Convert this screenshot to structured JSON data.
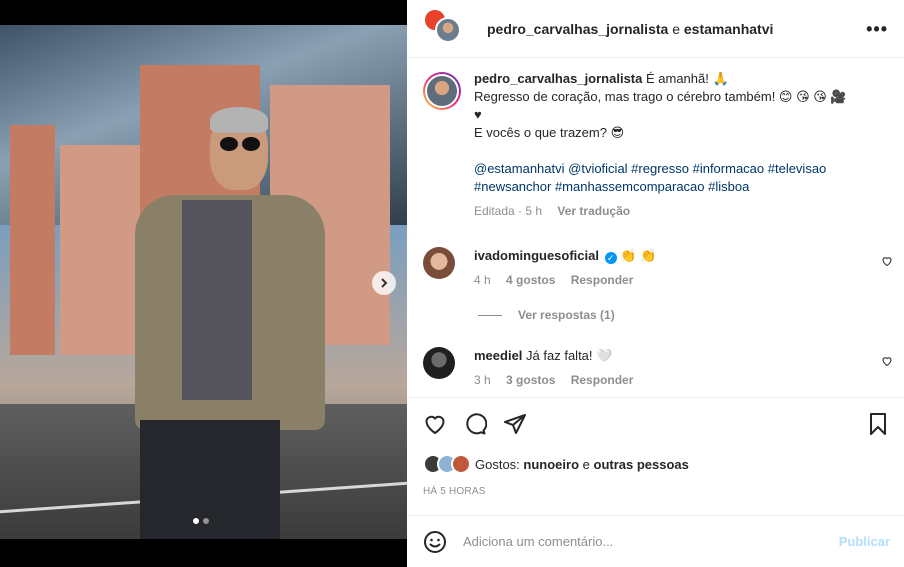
{
  "post": {
    "header_user": "pedro_carvalhas_jornalista",
    "header_connector": "e",
    "header_collab": "estamanhatvi"
  },
  "caption": {
    "username": "pedro_carvalhas_jornalista",
    "line1": "É amanhã! 🙏",
    "line2": "Regresso de coração, mas trago o cérebro também! 😊 😘 😘 🎥",
    "line3": "♥",
    "line4": "E vocês o que trazem? 😎",
    "tags_line1": "@estamanhatvi @tvioficial #regresso #informacao #televisao",
    "tags_line2": "#newsanchor #manhassemcomparacao #lisboa",
    "edited": "Editada · 5 h",
    "translate": "Ver tradução"
  },
  "comments": [
    {
      "username": "ivadominguesoficial",
      "text": "👏 👏",
      "time": "4 h",
      "likes": "4 gostos",
      "reply": "Responder",
      "avatar_color": "#b5846b"
    },
    {
      "username": "meediel",
      "text": "Já faz falta! 🤍",
      "time": "3 h",
      "likes": "3 gostos",
      "reply": "Responder",
      "avatar_color": "#2b2b2b"
    }
  ],
  "replies_label": "Ver respostas (1)",
  "likes": {
    "prefix": "Gostos:",
    "user": "nunoeiro",
    "connector": "e",
    "others": "outras pessoas"
  },
  "time_ago": "HÁ 5 HORAS",
  "add_comment": {
    "placeholder": "Adiciona um comentário...",
    "publish": "Publicar"
  },
  "colors": {
    "link": "#00376b",
    "muted": "#8e8e8e",
    "publish_disabled": "#b2dffc"
  },
  "icons": [
    "more-icon",
    "next-arrow-icon",
    "heart-icon",
    "comment-icon",
    "share-icon",
    "bookmark-icon",
    "emoji-icon"
  ]
}
